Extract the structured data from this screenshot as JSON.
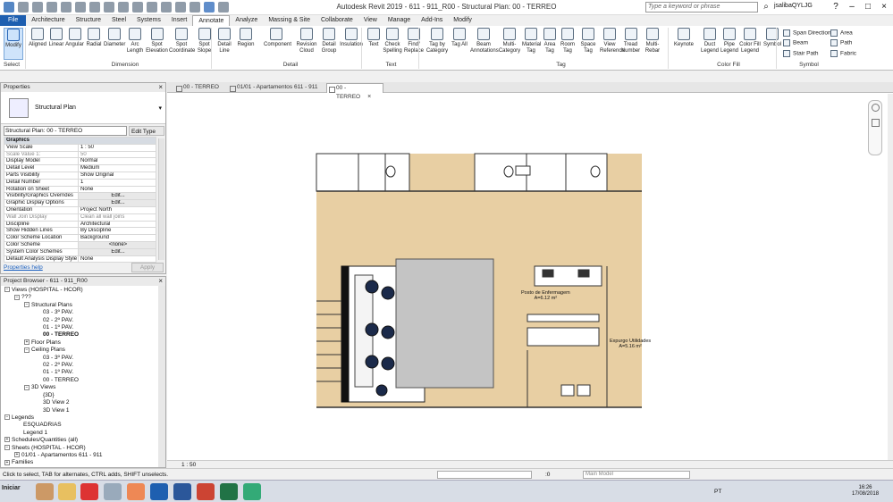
{
  "app": {
    "title": "Autodesk Revit 2019 - 611 - 911_R00 - Structural Plan: 00 - TERREO",
    "search_placeholder": "Type a keyword or phrase",
    "user": "jsalibaQYLJG"
  },
  "ribbon": {
    "tabs": [
      "File",
      "Architecture",
      "Structure",
      "Steel",
      "Systems",
      "Insert",
      "Annotate",
      "Analyze",
      "Massing & Site",
      "Collaborate",
      "View",
      "Manage",
      "Add-Ins",
      "Modify"
    ],
    "active_tab": "Annotate",
    "buttons": [
      {
        "label": "Modify"
      },
      {
        "label": "Aligned"
      },
      {
        "label": "Linear"
      },
      {
        "label": "Angular"
      },
      {
        "label": "Radial"
      },
      {
        "label": "Diameter"
      },
      {
        "label": "Arc Length"
      },
      {
        "label": "Spot Elevation"
      },
      {
        "label": "Spot Coordinate"
      },
      {
        "label": "Spot Slope"
      },
      {
        "label": "Detail Line"
      },
      {
        "label": "Region"
      },
      {
        "label": "Component"
      },
      {
        "label": "Revision Cloud"
      },
      {
        "label": "Detail Group"
      },
      {
        "label": "Insulation"
      },
      {
        "label": "Text"
      },
      {
        "label": "Check Spelling"
      },
      {
        "label": "Find/ Replace"
      },
      {
        "label": "Tag by Category"
      },
      {
        "label": "Tag All"
      },
      {
        "label": "Beam Annotations"
      },
      {
        "label": "Multi- Category"
      },
      {
        "label": "Material Tag"
      },
      {
        "label": "Area Tag"
      },
      {
        "label": "Room Tag"
      },
      {
        "label": "Space Tag"
      },
      {
        "label": "View Reference"
      },
      {
        "label": "Tread Number"
      },
      {
        "label": "Multi- Rebar"
      },
      {
        "label": "Keynote"
      },
      {
        "label": "Duct Legend"
      },
      {
        "label": "Pipe Legend"
      },
      {
        "label": "Color Fill Legend"
      },
      {
        "label": "Symbol"
      }
    ],
    "small_buttons": [
      "Span Direction",
      "Beam",
      "Stair Path",
      "Area",
      "Path",
      "Fabric"
    ],
    "panels": [
      "Select",
      "Dimension",
      "Detail",
      "Text",
      "Tag",
      "Color Fill",
      "Symbol"
    ]
  },
  "properties": {
    "title": "Properties",
    "type_name": "Structural Plan",
    "instance_selector": "Structural Plan: 00 - TERREO",
    "edit_type": "Edit Type",
    "group": "Graphics",
    "rows": [
      {
        "k": "View Scale",
        "v": "1 : 50"
      },
      {
        "k": "Scale Value    1:",
        "v": "50",
        "dis": true
      },
      {
        "k": "Display Model",
        "v": "Normal"
      },
      {
        "k": "Detail Level",
        "v": "Medium"
      },
      {
        "k": "Parts Visibility",
        "v": "Show Original"
      },
      {
        "k": "Detail Number",
        "v": "1"
      },
      {
        "k": "Rotation on Sheet",
        "v": "None"
      },
      {
        "k": "Visibility/Graphics Overrides",
        "v": "Edit...",
        "btn": true
      },
      {
        "k": "Graphic Display Options",
        "v": "Edit...",
        "btn": true
      },
      {
        "k": "Orientation",
        "v": "Project North"
      },
      {
        "k": "Wall Join Display",
        "v": "Clean all wall joins",
        "dis": true
      },
      {
        "k": "Discipline",
        "v": "Architectural"
      },
      {
        "k": "Show Hidden Lines",
        "v": "By Discipline"
      },
      {
        "k": "Color Scheme Location",
        "v": "Background"
      },
      {
        "k": "Color Scheme",
        "v": "<none>",
        "btn": true
      },
      {
        "k": "System Color Schemes",
        "v": "Edit...",
        "btn": true
      },
      {
        "k": "Default Analysis Display Style",
        "v": "None"
      }
    ],
    "help": "Properties help",
    "apply": "Apply"
  },
  "browser": {
    "title": "Project Browser - 611 - 911_R00",
    "items": [
      {
        "t": "Views (HOSPITAL - HCOR)",
        "lvl": 0,
        "bx": "-"
      },
      {
        "t": "???",
        "lvl": 1,
        "bx": "-"
      },
      {
        "t": "Structural Plans",
        "lvl": 2,
        "bx": "-"
      },
      {
        "t": "03 - 3º PAV.",
        "lvl": 3
      },
      {
        "t": "02 - 2º PAV.",
        "lvl": 3
      },
      {
        "t": "01 - 1º PAV.",
        "lvl": 3
      },
      {
        "t": "00 - TERREO",
        "lvl": 3,
        "bold": true
      },
      {
        "t": "Floor Plans",
        "lvl": 2,
        "bx": "+"
      },
      {
        "t": "Ceiling Plans",
        "lvl": 2,
        "bx": "-"
      },
      {
        "t": "03 - 3º PAV.",
        "lvl": 3
      },
      {
        "t": "02 - 2º PAV.",
        "lvl": 3
      },
      {
        "t": "01 - 1º PAV.",
        "lvl": 3
      },
      {
        "t": "00 - TERREO",
        "lvl": 3
      },
      {
        "t": "3D Views",
        "lvl": 2,
        "bx": "-"
      },
      {
        "t": "{3D}",
        "lvl": 3
      },
      {
        "t": "3D View 2",
        "lvl": 3
      },
      {
        "t": "3D View 1",
        "lvl": 3
      },
      {
        "t": "Legends",
        "lvl": 0,
        "bx": "-"
      },
      {
        "t": "ESQUADRIAS",
        "lvl": 1
      },
      {
        "t": "Legend 1",
        "lvl": 1
      },
      {
        "t": "Schedules/Quantities (all)",
        "lvl": 0,
        "bx": "+"
      },
      {
        "t": "Sheets (HOSPITAL - HCOR)",
        "lvl": 0,
        "bx": "-"
      },
      {
        "t": "01/01 - Apartamentos 611 - 911",
        "lvl": 1,
        "bx": "+"
      },
      {
        "t": "Families",
        "lvl": 0,
        "bx": "+"
      },
      {
        "t": "Groups",
        "lvl": 0,
        "bx": "+"
      }
    ]
  },
  "view_tabs": [
    {
      "label": "00 - TERREO"
    },
    {
      "label": "01/01 - Apartamentos 611 - 911"
    },
    {
      "label": "00 - TERREO",
      "active": true
    }
  ],
  "drawing": {
    "room1_name": "Posto de Enfermagem",
    "room1_area": "A=6.12 m²",
    "room2_name": "Expurgo Utilidades",
    "room2_area": "A=5.16 m²"
  },
  "view_control": {
    "scale": "1 : 50"
  },
  "status": {
    "hint": "Click to select, TAB for alternates, CTRL adds, SHIFT unselects.",
    "coord": ":0",
    "main_model": "Main Model"
  },
  "taskbar": {
    "start": "Iniciar",
    "lang": "PT",
    "time": "16:26",
    "date": "17/08/2018"
  }
}
